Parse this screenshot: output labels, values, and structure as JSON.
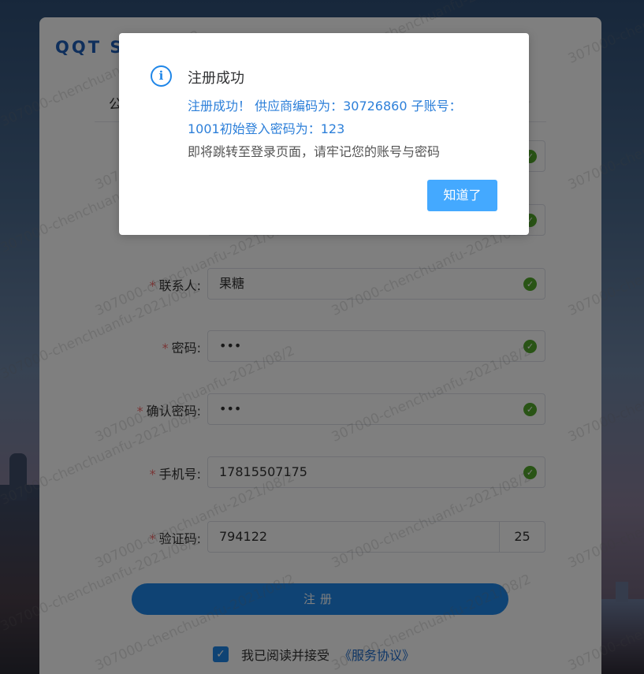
{
  "brand": "QQT SRM",
  "tab": {
    "label": "公司注册"
  },
  "form": {
    "fields": [
      {
        "label": "联系人:",
        "value": "果糖"
      },
      {
        "label": "密码:",
        "value": "•••"
      },
      {
        "label": "确认密码:",
        "value": "•••"
      },
      {
        "label": "手机号:",
        "value": "17815507175"
      },
      {
        "label": "验证码:",
        "value": "794122",
        "suffix": "25"
      }
    ],
    "required_mark": "*",
    "register_label": "注册",
    "agree_text": "我已阅读并接受",
    "agree_link": "《服务协议》"
  },
  "watermark": "307000-chenchuanfu-2021/08/2",
  "dialog": {
    "title": "注册成功",
    "message_blue": "注册成功！ 供应商编码为：30726860 子账号：1001初始登入密码为：123",
    "message_gray": "即将跳转至登录页面，请牢记您的账号与密码",
    "ok_label": "知道了",
    "icon": "info-circle-icon"
  },
  "colors": {
    "primary": "#1f86e8",
    "dialog_button": "#44a9ff",
    "valid": "#52a82a",
    "required": "#f56c6c"
  }
}
